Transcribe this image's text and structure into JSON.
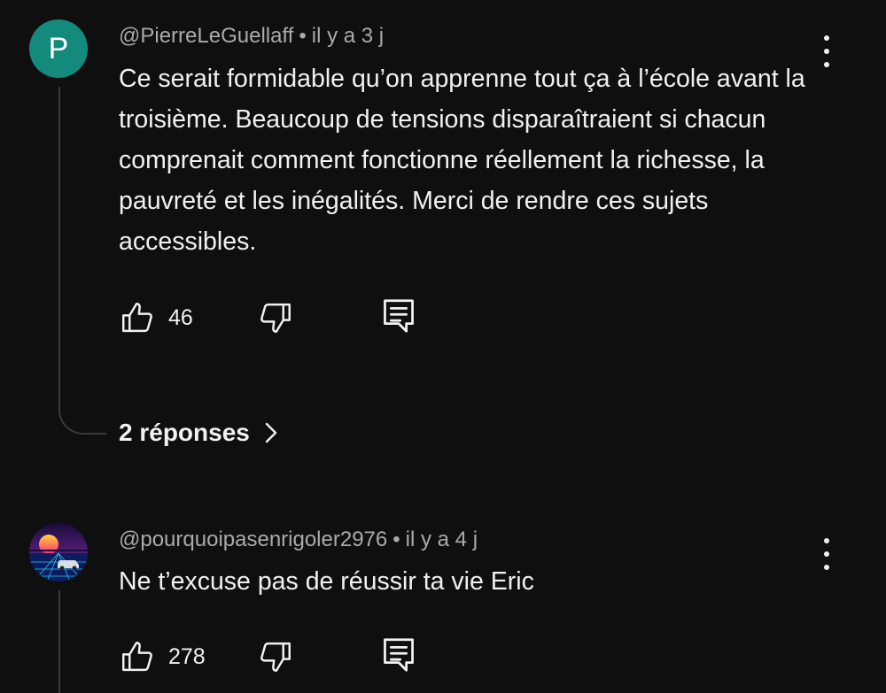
{
  "comments": [
    {
      "avatar_letter": "P",
      "avatar_color": "#138a7c",
      "author": "@PierreLeGuellaff",
      "separator": "•",
      "time": "il y a 3 j",
      "text": "Ce serait formidable qu’on apprenne tout ça à l’école avant la troisième. Beaucoup de tensions disparaîtraient si chacun comprenait comment fonctionne réellement la richesse, la pauvreté et les inégalités. Merci de rendre ces sujets accessibles.",
      "likes": "46",
      "replies_label": "2 réponses"
    },
    {
      "avatar_image": "synthwave-sunset-car-avatar",
      "author": "@pourquoipasenrigoler2976",
      "separator": "•",
      "time": "il y a 4 j",
      "text": "Ne t’excuse pas de réussir ta vie Eric",
      "likes": "278"
    }
  ],
  "icons": {
    "more": "more-vert-icon",
    "like": "thumb-up-icon",
    "dislike": "thumb-down-icon",
    "reply": "comment-reply-icon",
    "chevron": "chevron-right-icon"
  },
  "colors": {
    "background": "#0f0f0f",
    "text": "#f1f1f1",
    "meta": "#aaaaaa",
    "thread_line": "#3a3a3a"
  }
}
